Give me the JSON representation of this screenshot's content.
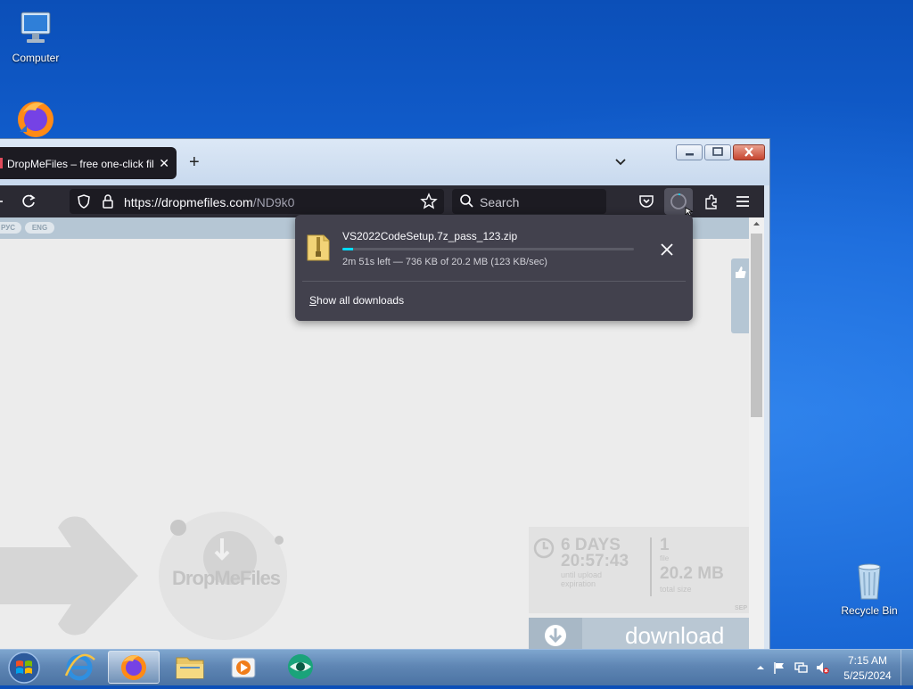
{
  "desktop": {
    "icons": [
      {
        "label": "Computer"
      },
      {
        "label": "Recycle Bin"
      }
    ]
  },
  "browser": {
    "tab": {
      "title": "DropMeFiles – free one-click fil"
    },
    "url": {
      "host": "https://dropmefiles.com",
      "path": "/ND9k0"
    },
    "search_placeholder": "Search"
  },
  "site": {
    "lang_ru": "РУС",
    "lang_en": "ENG",
    "logo": "DropMeFiles",
    "stats": {
      "days": "6 DAYS",
      "time": "20:57:43",
      "expiry_label_1": "until upload",
      "expiry_label_2": "expiration",
      "file_count": "1",
      "file_label": "file",
      "total_size": "20.2 MB",
      "size_label": "total size",
      "tag": "SEP"
    },
    "download_label": "download"
  },
  "downloads_panel": {
    "file_name": "VS2022CodeSetup.7z_pass_123.zip",
    "progress_percent": 3.6,
    "status": "2m 51s left — 736 KB of 20.2 MB (123 KB/sec)",
    "show_all_prefix": "S",
    "show_all_rest": "how all downloads"
  },
  "taskbar": {
    "time": "7:15 AM",
    "date": "5/25/2024"
  },
  "colors": {
    "accent": "#00ddff",
    "panel_bg": "#42414d",
    "toolbar_bg": "#2b2a33"
  }
}
